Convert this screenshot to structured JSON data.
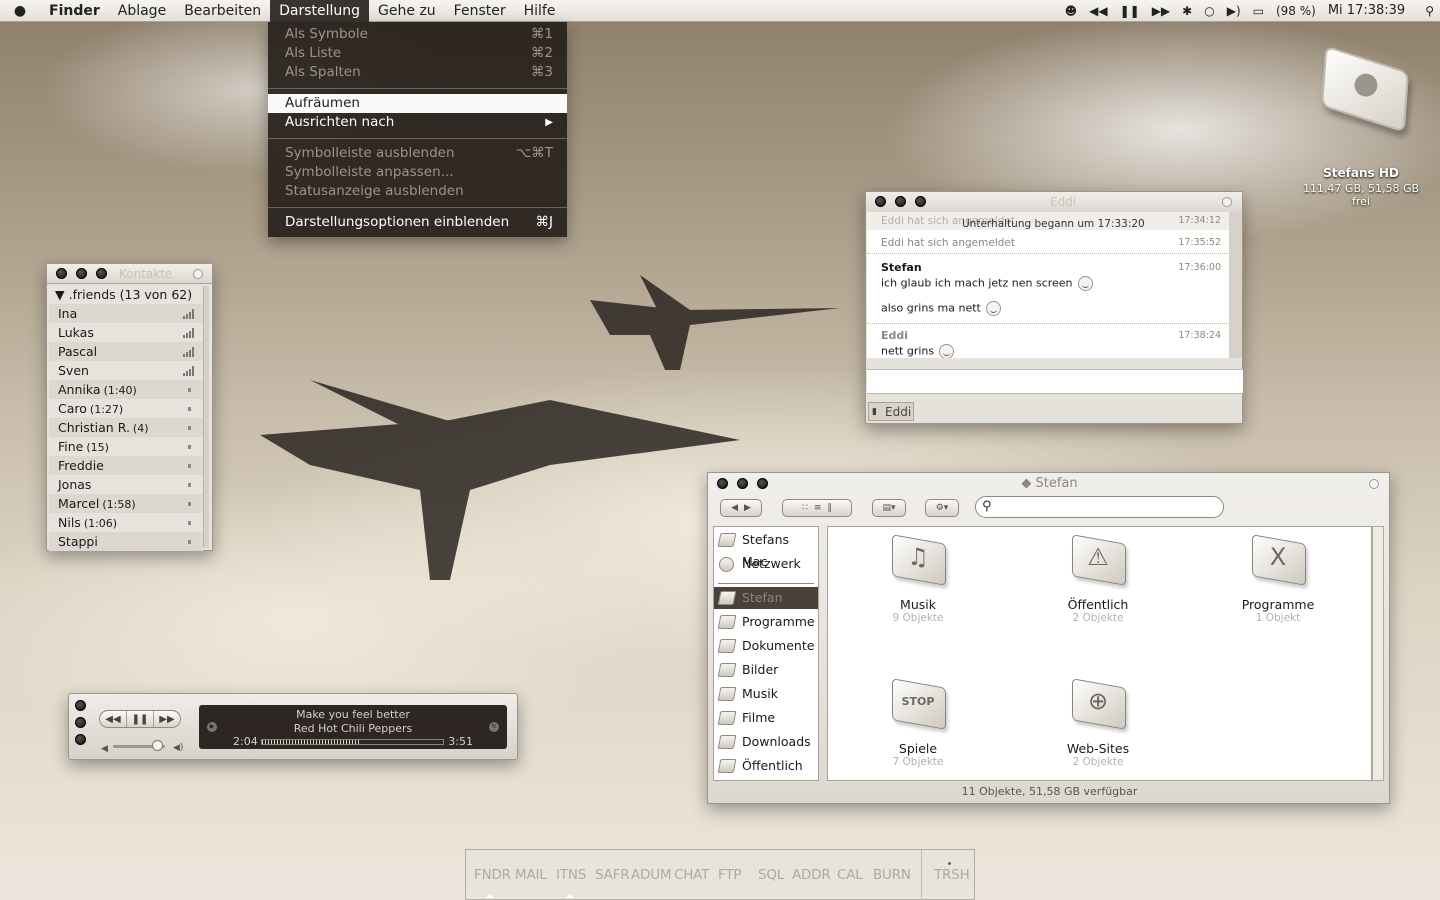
{
  "menubar": {
    "apple": "",
    "items": [
      "Finder",
      "Ablage",
      "Bearbeiten",
      "Darstellung",
      "Gehe zu",
      "Fenster",
      "Hilfe"
    ],
    "battery": "(98 %)",
    "clock": "Mi 17:38:39"
  },
  "view_menu": {
    "items": [
      {
        "label": "Als Symbole",
        "shortcut": "⌘1"
      },
      {
        "label": "Als Liste",
        "shortcut": "⌘2"
      },
      {
        "label": "Als Spalten",
        "shortcut": "⌘3"
      },
      {
        "label": "Aufräumen",
        "shortcut": ""
      },
      {
        "label": "Ausrichten nach",
        "shortcut": ""
      },
      {
        "label": "Symbolleiste ausblenden",
        "shortcut": "⌥⌘T"
      },
      {
        "label": "Symbolleiste anpassen...",
        "shortcut": ""
      },
      {
        "label": "Statusanzeige ausblenden",
        "shortcut": ""
      },
      {
        "label": "Darstellungsoptionen einblenden",
        "shortcut": "⌘J"
      }
    ]
  },
  "contacts": {
    "title": "Kontakte",
    "group": ".friends (13 von 62)",
    "buddies": [
      {
        "name": "Ina",
        "idle": ""
      },
      {
        "name": "Lukas",
        "idle": ""
      },
      {
        "name": "Pascal",
        "idle": ""
      },
      {
        "name": "Sven",
        "idle": ""
      },
      {
        "name": "Annika",
        "idle": "(1:40)"
      },
      {
        "name": "Caro",
        "idle": "(1:27)"
      },
      {
        "name": "Christian R.",
        "idle": "(4)"
      },
      {
        "name": "Fine",
        "idle": "(15)"
      },
      {
        "name": "Freddie",
        "idle": ""
      },
      {
        "name": "Jonas",
        "idle": ""
      },
      {
        "name": "Marcel",
        "idle": "(1:58)"
      },
      {
        "name": "Nils",
        "idle": "(1:06)"
      },
      {
        "name": "Stappi",
        "idle": ""
      }
    ]
  },
  "chat": {
    "title": "Eddi",
    "sys1": "Eddi hat sich angemeldet",
    "sys1_time": "17:34:12",
    "banner": "Unterhaltung begann um 17:33:20",
    "sys2": "Eddi hat sich angemeldet",
    "sys2_time": "17:35:52",
    "m1_who": "Stefan",
    "m1_time": "17:36:00",
    "m1_a": "ich glaub ich mach jetz nen screen",
    "m1_b": "also grins ma nett",
    "m2_who": "Eddi",
    "m2_time": "17:38:24",
    "m2_a": "nett grins",
    "tab": "Eddi"
  },
  "player": {
    "song": "Make you feel better",
    "artist": "Red Hot Chili Peppers",
    "elapsed": "2:04",
    "total": "3:51",
    "progress": 0.54,
    "volume": 0.85
  },
  "finder": {
    "title": "Stefan",
    "sidebar": [
      "Stefans Mac",
      "Netzwerk",
      "Stefan",
      "Programme",
      "Dokumente",
      "Bilder",
      "Musik",
      "Filme",
      "Downloads",
      "Öffentlich"
    ],
    "items": [
      {
        "name": "Musik",
        "count": "9 Objekte",
        "glyph": "♫"
      },
      {
        "name": "Öffentlich",
        "count": "2 Objekte",
        "glyph": "⚠"
      },
      {
        "name": "Programme",
        "count": "1 Objekt",
        "glyph": "X"
      },
      {
        "name": "Spiele",
        "count": "7 Objekte",
        "glyph": "STOP"
      },
      {
        "name": "Web-Sites",
        "count": "2 Objekte",
        "glyph": "⊕"
      }
    ],
    "status": "11 Objekte, 51,58 GB verfügbar"
  },
  "desktop": {
    "hd_name": "Stefans HD",
    "hd_info": "111,47 GB, 51,58 GB frei"
  },
  "dock": {
    "items": [
      "FNDR",
      "MAIL",
      "ITNS",
      "SAFR",
      "ADUM",
      "CHAT",
      "FTP",
      "SQL",
      "ADDR",
      "CAL",
      "BURN"
    ],
    "trash": "TRSH"
  }
}
